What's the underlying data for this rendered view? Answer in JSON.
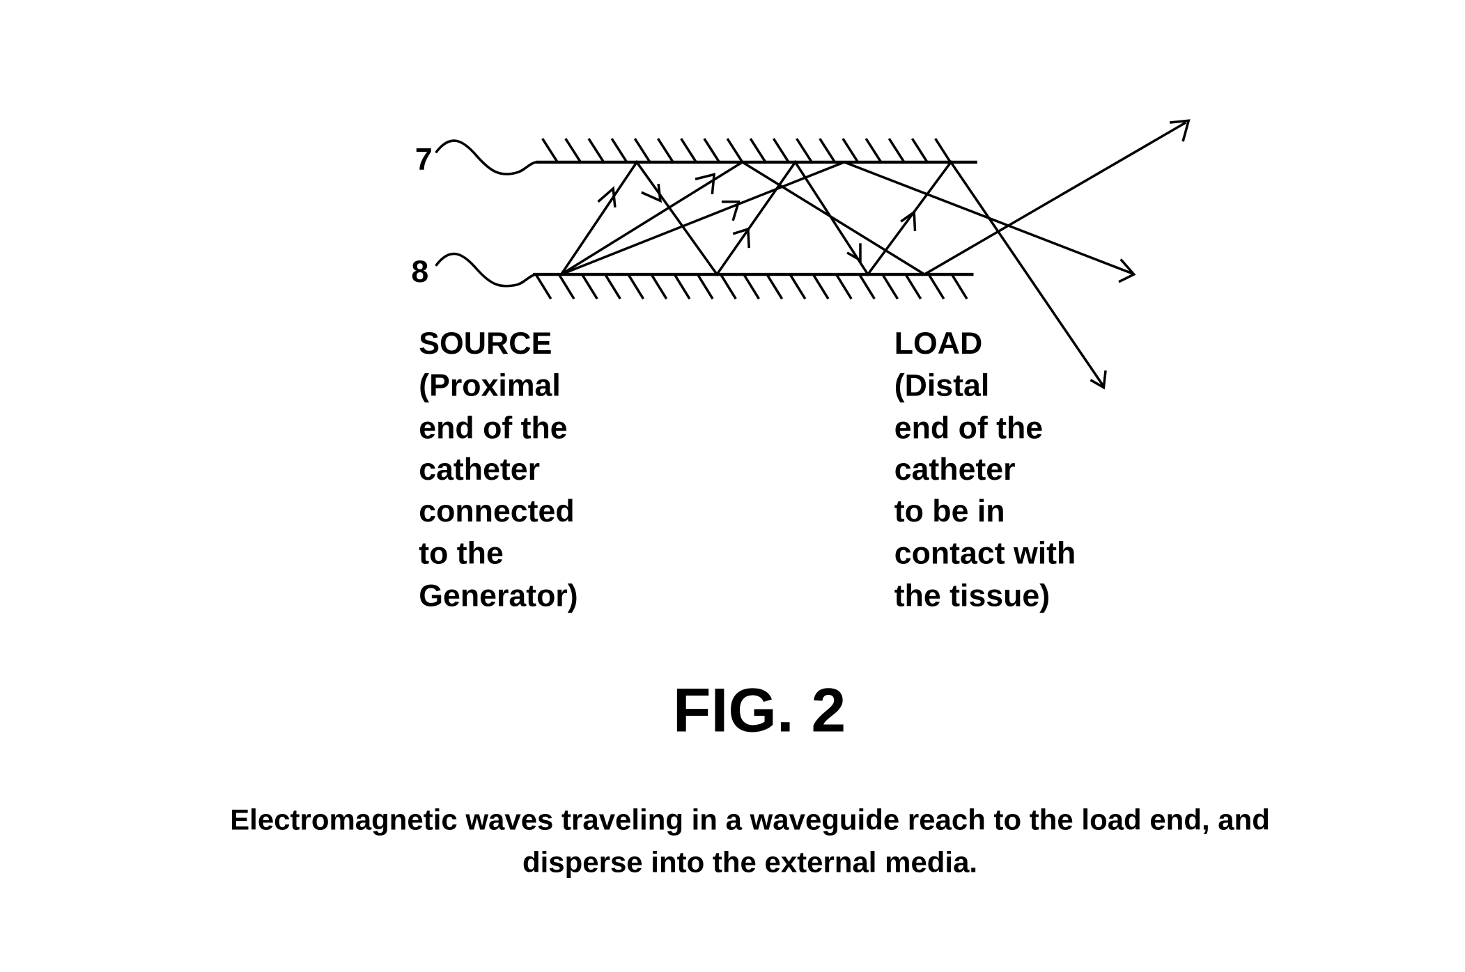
{
  "figure": {
    "label": "FIG. 2",
    "reference_numerals": {
      "top_wall": "7",
      "bottom_wall": "8"
    },
    "source_label": {
      "heading": "SOURCE",
      "lines": [
        "(Proximal",
        "end of the",
        "catheter",
        "connected",
        "to the",
        "Generator)"
      ]
    },
    "load_label": {
      "heading": "LOAD",
      "lines": [
        "(Distal",
        "end of the",
        "catheter",
        "to be in",
        "contact with",
        "the tissue)"
      ]
    },
    "caption": {
      "line1": "Electromagnetic waves traveling in a waveguide reach to the load end, and",
      "line2": "disperse into the external media."
    }
  }
}
